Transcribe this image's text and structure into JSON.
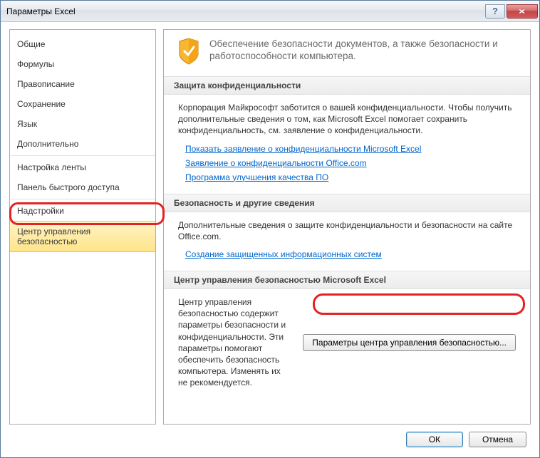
{
  "window": {
    "title": "Параметры Excel"
  },
  "sidebar": {
    "items": [
      {
        "label": "Общие"
      },
      {
        "label": "Формулы"
      },
      {
        "label": "Правописание"
      },
      {
        "label": "Сохранение"
      },
      {
        "label": "Язык"
      },
      {
        "label": "Дополнительно"
      },
      {
        "label": "Настройка ленты"
      },
      {
        "label": "Панель быстрого доступа"
      },
      {
        "label": "Надстройки"
      },
      {
        "label": "Центр управления безопасностью"
      }
    ]
  },
  "intro": {
    "text": "Обеспечение безопасности документов, а также безопасности и работоспособности компьютера."
  },
  "sections": {
    "privacy": {
      "header": "Защита конфиденциальности",
      "text": "Корпорация Майкрософт заботится о вашей конфиденциальности. Чтобы получить дополнительные сведения о том, как Microsoft Excel помогает сохранить конфиденциальность, см. заявление о конфиденциальности.",
      "links": [
        "Показать заявление о конфиденциальности Microsoft Excel",
        "Заявление о конфиденциальности Office.com",
        "Программа улучшения качества ПО"
      ]
    },
    "security": {
      "header": "Безопасность и другие сведения",
      "text": "Дополнительные сведения о защите конфиденциальности и безопасности на сайте Office.com.",
      "links": [
        "Создание защищенных информационных систем"
      ]
    },
    "trust": {
      "header": "Центр управления безопасностью Microsoft Excel",
      "text": "Центр управления безопасностью содержит параметры безопасности и конфиденциальности. Эти параметры помогают обеспечить безопасность компьютера. Изменять их не рекомендуется.",
      "button_label": "Параметры центра управления безопасностью..."
    }
  },
  "footer": {
    "ok": "ОК",
    "cancel": "Отмена"
  }
}
